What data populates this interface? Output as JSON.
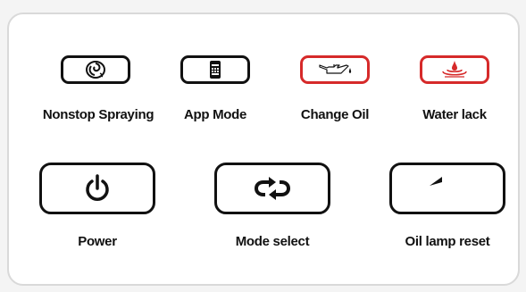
{
  "indicators": [
    {
      "label": "Nonstop Spraying",
      "icon": "spray-icon",
      "color": "#111111"
    },
    {
      "label": "App Mode",
      "icon": "phone-app-icon",
      "color": "#111111"
    },
    {
      "label": "Change Oil",
      "icon": "oil-can-icon",
      "color": "#d62a2a"
    },
    {
      "label": "Water lack",
      "icon": "water-drop-icon",
      "color": "#d62a2a"
    }
  ],
  "buttons": [
    {
      "label": "Power",
      "icon": "power-icon"
    },
    {
      "label": "Mode select",
      "icon": "cycle-arrows-icon"
    },
    {
      "label": "Oil lamp reset",
      "icon": "back-arrow-icon"
    }
  ]
}
